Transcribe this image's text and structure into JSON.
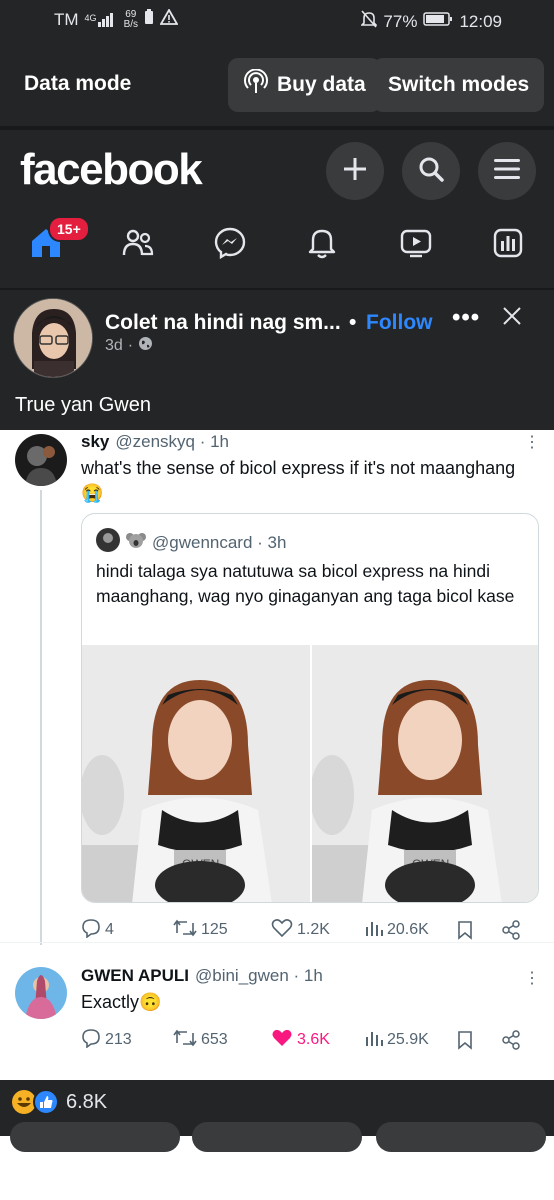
{
  "status_bar": {
    "carrier": "TM",
    "network": "4G",
    "speed_value": "69",
    "speed_unit": "B/s",
    "battery_percent": "77%",
    "time": "12:09"
  },
  "data_mode": {
    "label": "Data mode",
    "buy_data_label": "Buy data",
    "switch_modes_label": "Switch modes"
  },
  "header": {
    "logo": "facebook",
    "notification_badge": "15+"
  },
  "post": {
    "author": "Colet na hindi nag sm...",
    "follow_label": "Follow",
    "time": "3d",
    "text": "True yan Gwen"
  },
  "tweet1": {
    "name": "sky",
    "handle": "@zenskyq · 1h",
    "text": "what's the sense of bicol express if it's not maanghang",
    "emoji": "😭",
    "quote": {
      "handle": "@gwenncard · 3h",
      "text": "hindi talaga sya natutuwa sa bicol express na hindi maanghang, wag nyo ginaganyan ang taga bicol kase",
      "image_caption": "GWEN"
    },
    "actions": {
      "replies": "4",
      "retweets": "125",
      "likes": "1.2K",
      "views": "20.6K"
    }
  },
  "tweet2": {
    "name": "GWEN APULI",
    "handle": "@bini_gwen · 1h",
    "text": "Exactly",
    "emoji": "🙃",
    "actions": {
      "replies": "213",
      "retweets": "653",
      "likes": "3.6K",
      "views": "25.9K"
    }
  },
  "reactions": {
    "count": "6.8K"
  },
  "colors": {
    "fb_blue": "#2d88ff",
    "badge_red": "#e41e3f",
    "like_pink": "#f91880",
    "dark_bg": "#242526"
  }
}
